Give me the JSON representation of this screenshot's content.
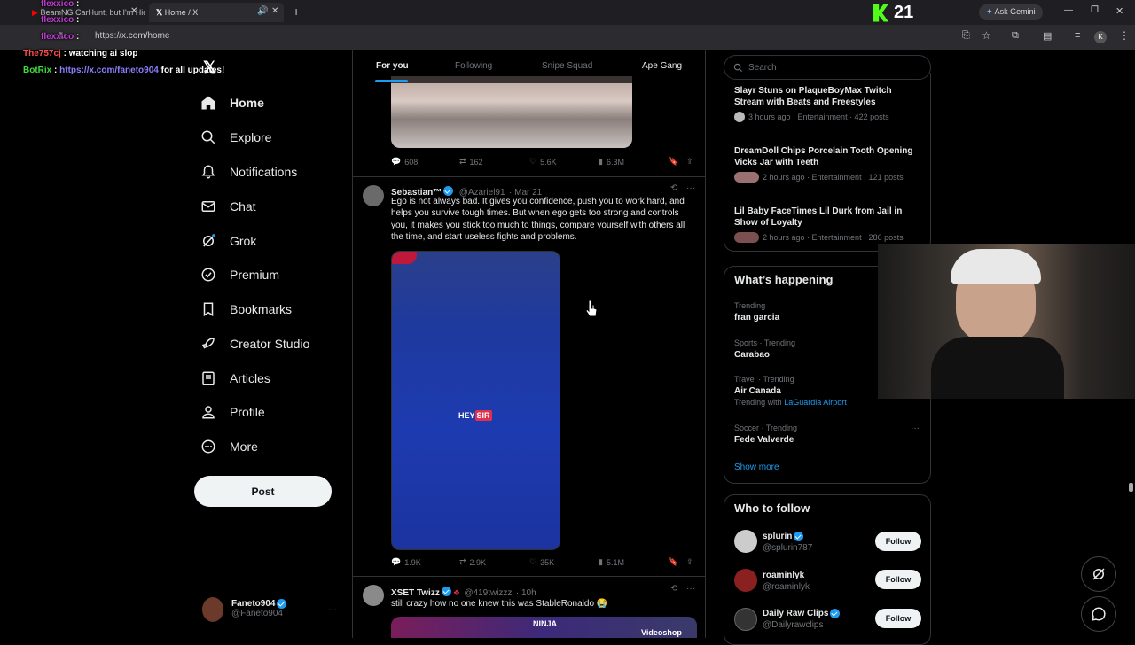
{
  "browser": {
    "tabs": [
      {
        "label": "BeamNG CarHunt, but I'm Hidi"
      },
      {
        "label": "Home / X"
      }
    ],
    "url": "https://x.com/home",
    "score": "21",
    "ask_gemini": "Ask Gemini",
    "new_tab": "+",
    "tab_close": "✕"
  },
  "chat_overlay": [
    {
      "user": "flexxico",
      "text": ":",
      "color": "#c23cd6"
    },
    {
      "user": "flexxico",
      "text": ":",
      "color": "#c23cd6"
    },
    {
      "user": "flexxico",
      "text": ":",
      "color": "#c23cd6"
    },
    {
      "user": "The757cj",
      "text": ": watching ai slop",
      "color": "#ff4d4d"
    },
    {
      "user": "BotRix",
      "text": ":",
      "color": "#3ddc3d",
      "link": "https://x.com/faneto904",
      "suffix": "for all updates!"
    }
  ],
  "nav": {
    "items": [
      {
        "label": "Home",
        "icon": "home-icon"
      },
      {
        "label": "Explore",
        "icon": "search-icon"
      },
      {
        "label": "Notifications",
        "icon": "bell-icon"
      },
      {
        "label": "Chat",
        "icon": "mail-icon"
      },
      {
        "label": "Grok",
        "icon": "grok-icon"
      },
      {
        "label": "Premium",
        "icon": "premium-icon"
      },
      {
        "label": "Bookmarks",
        "icon": "bookmark-icon"
      },
      {
        "label": "Creator Studio",
        "icon": "rocket-icon"
      },
      {
        "label": "Articles",
        "icon": "article-icon"
      },
      {
        "label": "Profile",
        "icon": "person-icon"
      },
      {
        "label": "More",
        "icon": "more-circle-icon"
      }
    ],
    "post_label": "Post",
    "account": {
      "name": "Faneto904",
      "handle": "@Faneto904",
      "more": "···"
    }
  },
  "feed": {
    "tabs": [
      "For you",
      "Following",
      "Snipe Squad",
      "Ape Gang"
    ],
    "tweet1_stats": {
      "replies": "608",
      "reposts": "162",
      "likes": "5.6K",
      "views": "6.3M"
    },
    "tweet2": {
      "name": "Sebastian™",
      "handle": "@Azariel91",
      "date": "· Mar 21",
      "text_lines": [
        "Ego is not always bad. It gives you confidence, push you to work hard, and",
        "helps you survive tough times. But when ego gets too strong and controls",
        "you, it makes you stick too much to things, compare yourself with others all",
        "the time, and start useless fights and problems."
      ],
      "video_caption_left": "HEY",
      "video_caption_right": "SIR",
      "stats": {
        "replies": "1.9K",
        "reposts": "2.9K",
        "likes": "35K",
        "views": "5.1M"
      }
    },
    "tweet3": {
      "name": "XSET Twizz",
      "handle": "@419twizzz",
      "date": "· 10h",
      "text": "still crazy how no one knew this was StableRonaldo 😭",
      "media_label_center": "NINJA",
      "media_label_right": "Videoshop"
    },
    "more": "···"
  },
  "right": {
    "search_placeholder": "Search",
    "news": [
      {
        "title_lines": [
          "Slayr Stuns on PlaqueBoyMax Twitch",
          "Stream with Beats and Freestyles"
        ],
        "meta": "3 hours ago · Entertainment · 422 posts"
      },
      {
        "title_lines": [
          "DreamDoll Chips Porcelain Tooth Opening",
          "Vicks Jar with Teeth"
        ],
        "meta": "2 hours ago · Entertainment · 121 posts"
      },
      {
        "title_lines": [
          "Lil Baby FaceTimes Lil Durk from Jail in",
          "Show of Loyalty"
        ],
        "meta": "2 hours ago · Entertainment · 286 posts"
      }
    ],
    "happening_title": "What’s happening",
    "trends": [
      {
        "category": "Trending",
        "title": "fran garcia"
      },
      {
        "category": "Sports · Trending",
        "title": "Carabao"
      },
      {
        "category": "Travel · Trending",
        "title": "Air Canada",
        "extra_prefix": "Trending with",
        "extra_link": "LaGuardia Airport"
      },
      {
        "category": "Soccer · Trending",
        "title": "Fede Valverde"
      }
    ],
    "show_more": "Show more",
    "who_title": "Who to follow",
    "follow": [
      {
        "name": "splurin",
        "handle": "@splurin787",
        "button": "Follow"
      },
      {
        "name": "roaminlyk",
        "handle": "@roaminlyk",
        "button": "Follow"
      },
      {
        "name": "Daily Raw Clips",
        "handle": "@Dailyrawclips",
        "button": "Follow"
      }
    ]
  },
  "colors": {
    "accent": "#1d9bf0",
    "background": "#000000",
    "border": "#2f3336",
    "muted": "#71767b",
    "score_green": "#53fc18"
  }
}
